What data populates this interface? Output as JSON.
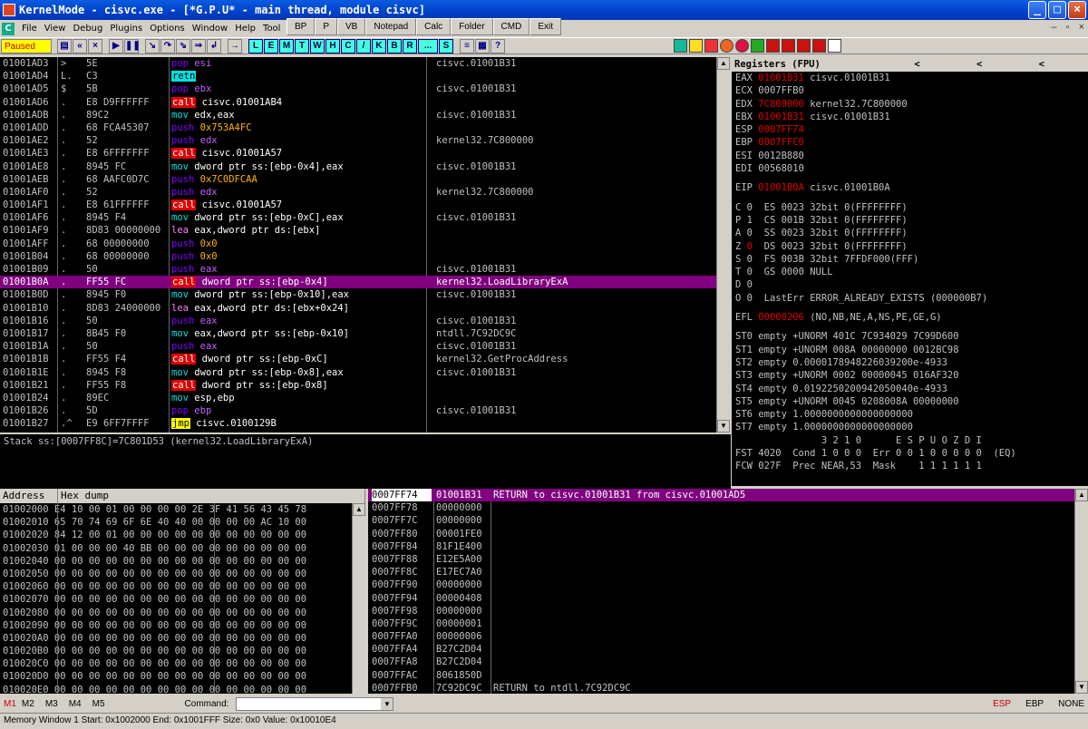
{
  "title": "KernelMode - cisvc.exe - [*G.P.U* - main thread, module cisvc]",
  "menu": [
    "File",
    "View",
    "Debug",
    "Plugins",
    "Options",
    "Window",
    "Help",
    "Tool"
  ],
  "plugin_buttons": [
    "BP",
    "P",
    "VB",
    "Notepad",
    "Calc",
    "Folder",
    "CMD",
    "Exit"
  ],
  "state": "Paused",
  "toolbar_letters": [
    "L",
    "E",
    "M",
    "T",
    "W",
    "H",
    "C",
    "/",
    "K",
    "B",
    "R",
    "...",
    "S"
  ],
  "colors": {
    "accent": "#800080",
    "call_bg": "#e00000",
    "mov": "#00e0e0",
    "push": "#8000ff"
  },
  "cpu_rows": [
    {
      "addr": "01001AD3",
      "mark": ">",
      "hex": "5E",
      "mn": "pop",
      "ops": "esi",
      "comment": "cisvc.01001B31"
    },
    {
      "addr": "01001AD4",
      "mark": "L.",
      "hex": "C3",
      "mn": "retn",
      "ops": "",
      "comment": ""
    },
    {
      "addr": "01001AD5",
      "mark": "$",
      "hex": "5B",
      "mn": "pop",
      "ops": "ebx",
      "comment": "cisvc.01001B31"
    },
    {
      "addr": "01001AD6",
      "mark": ".",
      "hex": "E8 D9FFFFFF",
      "mn": "call",
      "ops": "cisvc.01001AB4",
      "comment": ""
    },
    {
      "addr": "01001ADB",
      "mark": ".",
      "hex": "89C2",
      "mn": "mov",
      "ops": "edx,eax",
      "comment": "cisvc.01001B31"
    },
    {
      "addr": "01001ADD",
      "mark": ".",
      "hex": "68 FCA45307",
      "mn": "push",
      "ops": "0x753A4FC",
      "comment": ""
    },
    {
      "addr": "01001AE2",
      "mark": ".",
      "hex": "52",
      "mn": "push",
      "ops": "edx",
      "comment": "kernel32.7C800000"
    },
    {
      "addr": "01001AE3",
      "mark": ".",
      "hex": "E8 6FFFFFFF",
      "mn": "call",
      "ops": "cisvc.01001A57",
      "comment": ""
    },
    {
      "addr": "01001AE8",
      "mark": ".",
      "hex": "8945 FC",
      "mn": "mov",
      "ops": "dword ptr ss:[ebp-0x4],eax",
      "comment": "cisvc.01001B31"
    },
    {
      "addr": "01001AEB",
      "mark": ".",
      "hex": "68 AAFC0D7C",
      "mn": "push",
      "ops": "0x7C0DFCAA",
      "comment": ""
    },
    {
      "addr": "01001AF0",
      "mark": ".",
      "hex": "52",
      "mn": "push",
      "ops": "edx",
      "comment": "kernel32.7C800000"
    },
    {
      "addr": "01001AF1",
      "mark": ".",
      "hex": "E8 61FFFFFF",
      "mn": "call",
      "ops": "cisvc.01001A57",
      "comment": ""
    },
    {
      "addr": "01001AF6",
      "mark": ".",
      "hex": "8945 F4",
      "mn": "mov",
      "ops": "dword ptr ss:[ebp-0xC],eax",
      "comment": "cisvc.01001B31"
    },
    {
      "addr": "01001AF9",
      "mark": ".",
      "hex": "8D83 00000000",
      "mn": "lea",
      "ops": "eax,dword ptr ds:[ebx]",
      "comment": ""
    },
    {
      "addr": "01001AFF",
      "mark": ".",
      "hex": "68 00000000",
      "mn": "push",
      "ops": "0x0",
      "comment": ""
    },
    {
      "addr": "01001B04",
      "mark": ".",
      "hex": "68 00000000",
      "mn": "push",
      "ops": "0x0",
      "comment": ""
    },
    {
      "addr": "01001B09",
      "mark": ".",
      "hex": "50",
      "mn": "push",
      "ops": "eax",
      "comment": "cisvc.01001B31"
    },
    {
      "addr": "01001B0A",
      "mark": ".",
      "hex": "FF55 FC",
      "mn": "call",
      "ops": "dword ptr ss:[ebp-0x4]",
      "comment": "kernel32.LoadLibraryExA",
      "current": true
    },
    {
      "addr": "01001B0D",
      "mark": ".",
      "hex": "8945 F0",
      "mn": "mov",
      "ops": "dword ptr ss:[ebp-0x10],eax",
      "comment": "cisvc.01001B31"
    },
    {
      "addr": "01001B10",
      "mark": ".",
      "hex": "8D83 24000000",
      "mn": "lea",
      "ops": "eax,dword ptr ds:[ebx+0x24]",
      "comment": ""
    },
    {
      "addr": "01001B16",
      "mark": ".",
      "hex": "50",
      "mn": "push",
      "ops": "eax",
      "comment": "cisvc.01001B31"
    },
    {
      "addr": "01001B17",
      "mark": ".",
      "hex": "8B45 F0",
      "mn": "mov",
      "ops": "eax,dword ptr ss:[ebp-0x10]",
      "comment": "ntdll.7C92DC9C"
    },
    {
      "addr": "01001B1A",
      "mark": ".",
      "hex": "50",
      "mn": "push",
      "ops": "eax",
      "comment": "cisvc.01001B31"
    },
    {
      "addr": "01001B1B",
      "mark": ".",
      "hex": "FF55 F4",
      "mn": "call",
      "ops": "dword ptr ss:[ebp-0xC]",
      "comment": "kernel32.GetProcAddress"
    },
    {
      "addr": "01001B1E",
      "mark": ".",
      "hex": "8945 F8",
      "mn": "mov",
      "ops": "dword ptr ss:[ebp-0x8],eax",
      "comment": "cisvc.01001B31"
    },
    {
      "addr": "01001B21",
      "mark": ".",
      "hex": "FF55 F8",
      "mn": "call",
      "ops": "dword ptr ss:[ebp-0x8]",
      "comment": ""
    },
    {
      "addr": "01001B24",
      "mark": ".",
      "hex": "89EC",
      "mn": "mov",
      "ops": "esp,ebp",
      "comment": ""
    },
    {
      "addr": "01001B26",
      "mark": ".",
      "hex": "5D",
      "mn": "pop",
      "ops": "ebp",
      "comment": "cisvc.01001B31"
    },
    {
      "addr": "01001B27",
      "mark": ".^",
      "hex": "E9 6FF7FFFF",
      "mn": "jmp",
      "ops": "cisvc.0100129B",
      "comment": ""
    }
  ],
  "info_line": "Stack ss:[0007FF8C]=7C801D53 (kernel32.LoadLibraryExA)",
  "registers_header": "Registers (FPU)",
  "registers_arrows": "< < <",
  "registers": [
    {
      "name": "EAX",
      "val": "01001B31",
      "red": true,
      "desc": "cisvc.01001B31"
    },
    {
      "name": "ECX",
      "val": "0007FFB0",
      "red": false,
      "desc": ""
    },
    {
      "name": "EDX",
      "val": "7C800000",
      "red": true,
      "desc": "kernel32.7C800000"
    },
    {
      "name": "EBX",
      "val": "01001B31",
      "red": true,
      "desc": "cisvc.01001B31"
    },
    {
      "name": "ESP",
      "val": "0007FF74",
      "red": true,
      "desc": ""
    },
    {
      "name": "EBP",
      "val": "0007FFC0",
      "red": true,
      "desc": ""
    },
    {
      "name": "ESI",
      "val": "0012B880",
      "red": false,
      "desc": ""
    },
    {
      "name": "EDI",
      "val": "00568010",
      "red": false,
      "desc": ""
    }
  ],
  "eip": {
    "name": "EIP",
    "val": "01001B0A",
    "desc": "cisvc.01001B0A"
  },
  "flags": [
    {
      "f": "C",
      "v": "0",
      "red": false,
      "rest": "ES 0023 32bit 0(FFFFFFFF)"
    },
    {
      "f": "P",
      "v": "1",
      "red": false,
      "rest": "CS 001B 32bit 0(FFFFFFFF)"
    },
    {
      "f": "A",
      "v": "0",
      "red": false,
      "rest": "SS 0023 32bit 0(FFFFFFFF)"
    },
    {
      "f": "Z",
      "v": "0",
      "red": true,
      "rest": "DS 0023 32bit 0(FFFFFFFF)"
    },
    {
      "f": "S",
      "v": "0",
      "red": false,
      "rest": "FS 003B 32bit 7FFDF000(FFF)"
    },
    {
      "f": "T",
      "v": "0",
      "red": false,
      "rest": "GS 0000 NULL"
    },
    {
      "f": "D",
      "v": "0",
      "red": false,
      "rest": ""
    },
    {
      "f": "O",
      "v": "0",
      "red": false,
      "rest": "LastErr ERROR_ALREADY_EXISTS (000000B7)"
    }
  ],
  "efl": {
    "name": "EFL",
    "val": "00000206",
    "desc": "(NO,NB,NE,A,NS,PE,GE,G)"
  },
  "fpu": [
    "ST0 empty +UNORM 401C 7C934029 7C99D600",
    "ST1 empty +UNORM 008A 00000000 0012BC98",
    "ST2 empty 0.0000178948226039200e-4933",
    "ST3 empty +UNORM 0002 00000045 016AF320",
    "ST4 empty 0.0192250200942050040e-4933",
    "ST5 empty +UNORM 0045 0208008A 00000000",
    "ST6 empty 1.0000000000000000000",
    "ST7 empty 1.0000000000000000000"
  ],
  "fpu_bits_header": "               3 2 1 0      E S P U O Z D I",
  "fst": "FST 4020  Cond 1 0 0 0  Err 0 0 1 0 0 0 0 0  (EQ)",
  "fcw": "FCW 027F  Prec NEAR,53  Mask    1 1 1 1 1 1",
  "dump_headers": [
    "Address",
    "Hex dump"
  ],
  "dump_rows": [
    {
      "addr": "01002000",
      "hex": "E4 10 00 01 00 00 00 00 2E 3F 41 56 43 45 78"
    },
    {
      "addr": "01002010",
      "hex": "65 70 74 69 6F 6E 40 40 00 00 00 00 AC 10 00"
    },
    {
      "addr": "01002020",
      "hex": "84 12 00 01 00 00 00 00 00 00 00 00 00 00 00"
    },
    {
      "addr": "01002030",
      "hex": "01 00 00 00 40 BB 00 00 00 00 00 00 00 00 00"
    },
    {
      "addr": "01002040",
      "hex": "00 00 00 00 00 00 00 00 00 00 00 00 00 00 00"
    },
    {
      "addr": "01002050",
      "hex": "00 00 00 00 00 00 00 00 00 00 00 00 00 00 00"
    },
    {
      "addr": "01002060",
      "hex": "00 00 00 00 00 00 00 00 00 00 00 00 00 00 00"
    },
    {
      "addr": "01002070",
      "hex": "00 00 00 00 00 00 00 00 00 00 00 00 00 00 00"
    },
    {
      "addr": "01002080",
      "hex": "00 00 00 00 00 00 00 00 00 00 00 00 00 00 00"
    },
    {
      "addr": "01002090",
      "hex": "00 00 00 00 00 00 00 00 00 00 00 00 00 00 00"
    },
    {
      "addr": "010020A0",
      "hex": "00 00 00 00 00 00 00 00 00 00 00 00 00 00 00"
    },
    {
      "addr": "010020B0",
      "hex": "00 00 00 00 00 00 00 00 00 00 00 00 00 00 00"
    },
    {
      "addr": "010020C0",
      "hex": "00 00 00 00 00 00 00 00 00 00 00 00 00 00 00"
    },
    {
      "addr": "010020D0",
      "hex": "00 00 00 00 00 00 00 00 00 00 00 00 00 00 00"
    },
    {
      "addr": "010020E0",
      "hex": "00 00 00 00 00 00 00 00 00 00 00 00 00 00 00"
    }
  ],
  "stack_rows": [
    {
      "addr": "0007FF74",
      "val": "01001B31",
      "comment": "RETURN to cisvc.01001B31 from cisvc.01001AD5"
    },
    {
      "addr": "0007FF78",
      "val": "00000000",
      "comment": ""
    },
    {
      "addr": "0007FF7C",
      "val": "00000000",
      "comment": ""
    },
    {
      "addr": "0007FF80",
      "val": "00001FE0",
      "comment": ""
    },
    {
      "addr": "0007FF84",
      "val": "81F1E400",
      "comment": ""
    },
    {
      "addr": "0007FF88",
      "val": "E12E5A00",
      "comment": ""
    },
    {
      "addr": "0007FF8C",
      "val": "E17EC7A0",
      "comment": ""
    },
    {
      "addr": "0007FF90",
      "val": "00000000",
      "comment": ""
    },
    {
      "addr": "0007FF94",
      "val": "00000408",
      "comment": ""
    },
    {
      "addr": "0007FF98",
      "val": "00000000",
      "comment": ""
    },
    {
      "addr": "0007FF9C",
      "val": "00000001",
      "comment": ""
    },
    {
      "addr": "0007FFA0",
      "val": "00000006",
      "comment": ""
    },
    {
      "addr": "0007FFA4",
      "val": "B27C2D04",
      "comment": ""
    },
    {
      "addr": "0007FFA8",
      "val": "B27C2D04",
      "comment": ""
    },
    {
      "addr": "0007FFAC",
      "val": "8061850D",
      "comment": ""
    },
    {
      "addr": "0007FFB0",
      "val": "7C92DC9C",
      "comment": "RETURN to ntdll.7C92DC9C"
    }
  ],
  "cmdbar": {
    "marks": [
      "M1",
      "M2",
      "M3",
      "M4",
      "M5"
    ],
    "command_label": "Command:",
    "command_value": "",
    "right": [
      "ESP",
      "EBP",
      "NONE"
    ]
  },
  "status_text": "Memory Window 1  Start: 0x1002000  End: 0x1001FFF  Size: 0x0  Value: 0x10010E4"
}
